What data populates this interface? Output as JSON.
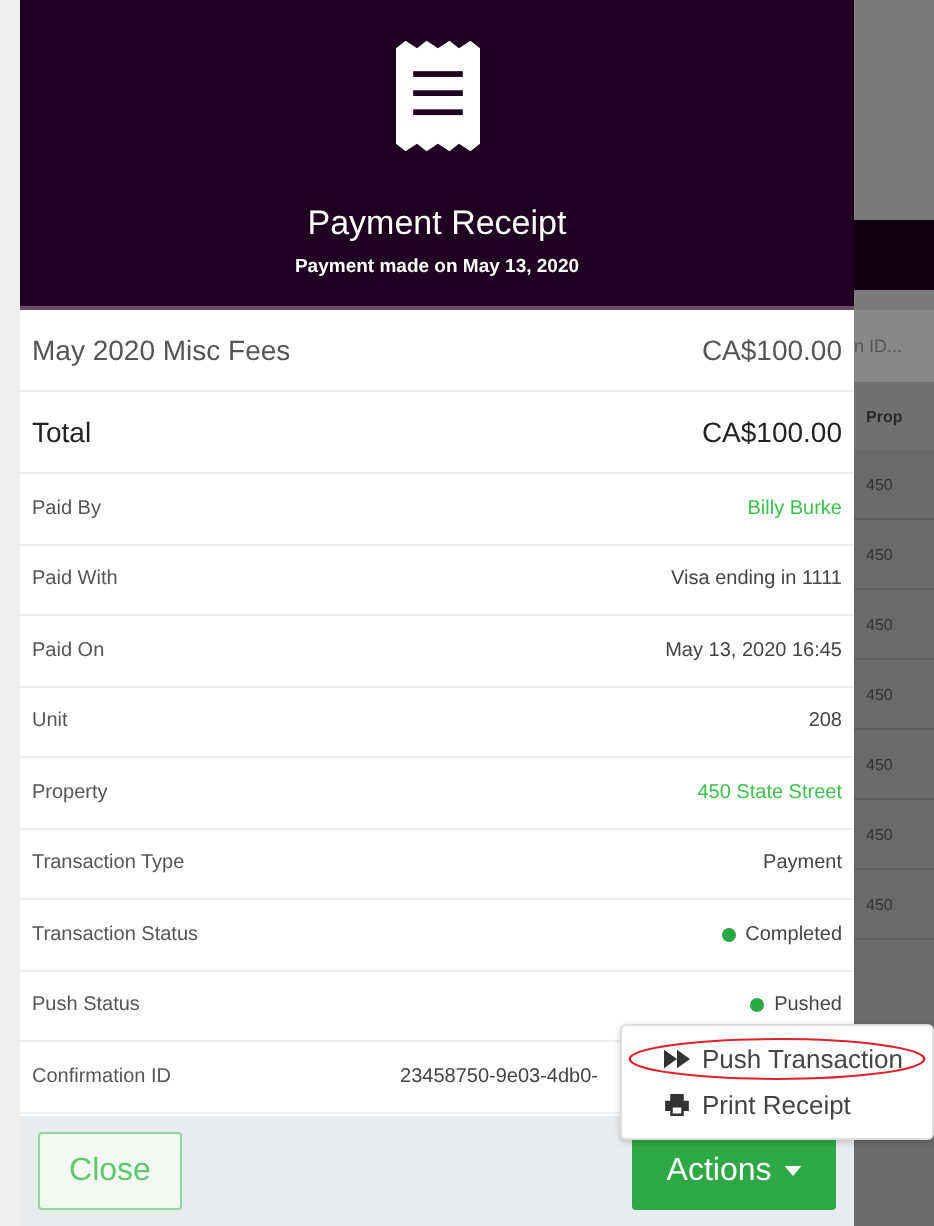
{
  "modal": {
    "title": "Payment Receipt",
    "subtitle": "Payment made on May 13, 2020",
    "line_items": [
      {
        "label": "May 2020 Misc Fees",
        "amount": "CA$100.00",
        "kind": "item"
      },
      {
        "label": "Total",
        "amount": "CA$100.00",
        "kind": "total"
      }
    ],
    "details": [
      {
        "label": "Paid By",
        "value": "Billy Burke",
        "kind": "link"
      },
      {
        "label": "Paid With",
        "value": "Visa ending in 1111",
        "kind": "text"
      },
      {
        "label": "Paid On",
        "value": "May 13, 2020 16:45",
        "kind": "text"
      },
      {
        "label": "Unit",
        "value": "208",
        "kind": "text"
      },
      {
        "label": "Property",
        "value": "450 State Street",
        "kind": "link"
      },
      {
        "label": "Transaction Type",
        "value": "Payment",
        "kind": "text"
      },
      {
        "label": "Transaction Status",
        "value": "Completed",
        "kind": "status",
        "color": "#28a745"
      },
      {
        "label": "Push Status",
        "value": "Pushed",
        "kind": "status",
        "color": "#28a745"
      },
      {
        "label": "Confirmation ID",
        "value": "23458750-9e03-4db0-",
        "kind": "text"
      }
    ],
    "close_button": "Close",
    "actions_button": "Actions",
    "actions_menu": [
      {
        "label": "Push Transaction",
        "highlighted": true
      },
      {
        "label": "Print Receipt",
        "highlighted": false
      }
    ]
  },
  "background": {
    "search_placeholder": "n ID...",
    "column": "Prop",
    "cells": [
      "450",
      "450",
      "450",
      "450",
      "450",
      "450",
      "450"
    ]
  }
}
